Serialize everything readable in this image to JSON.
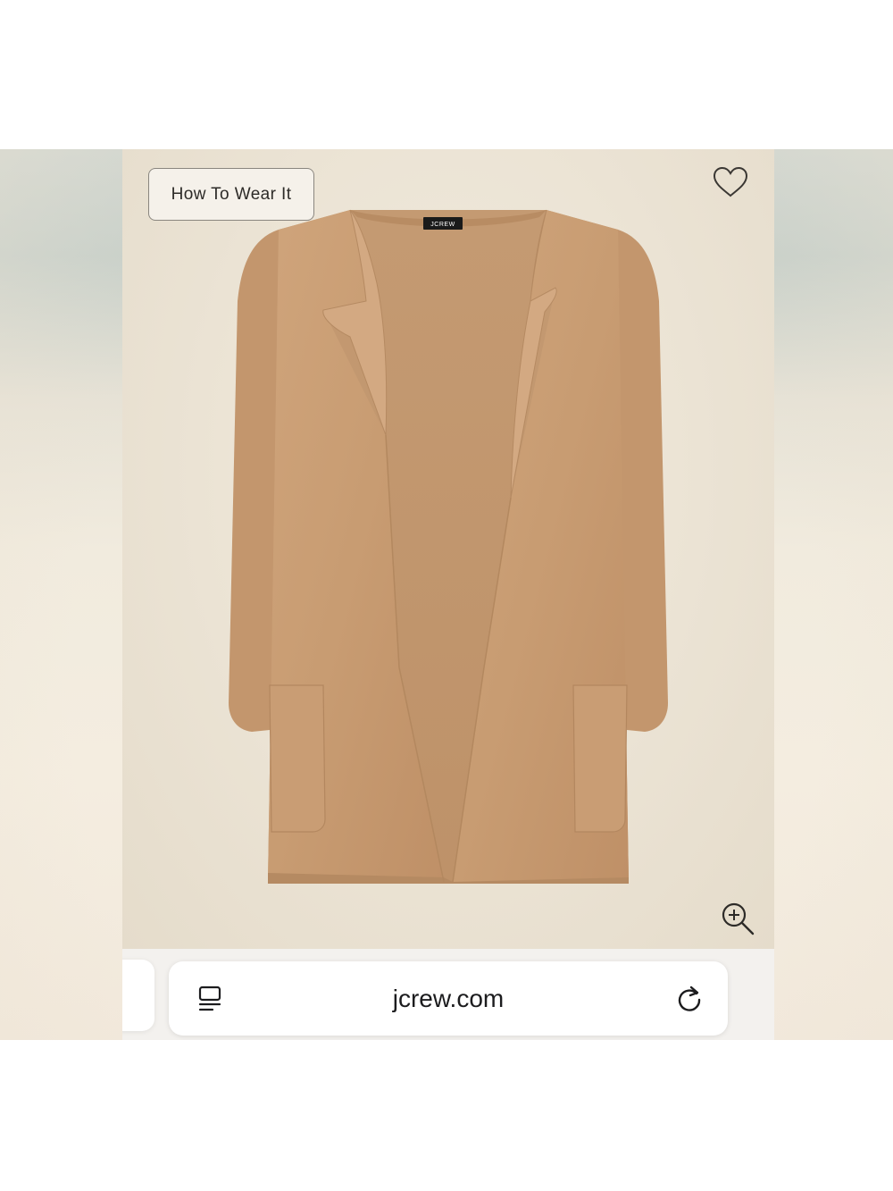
{
  "product": {
    "how_to_wear_label": "How To Wear It",
    "brand_tag": "JCREW",
    "image_description": "camel open-front sweater coat",
    "colors": {
      "coat": "#c79b72",
      "background": "#ede6d8"
    }
  },
  "icons": {
    "favorite": "heart-icon",
    "zoom": "zoom-in-icon",
    "tabs": "tabs-icon",
    "reload": "reload-icon"
  },
  "browser": {
    "url": "jcrew.com"
  }
}
